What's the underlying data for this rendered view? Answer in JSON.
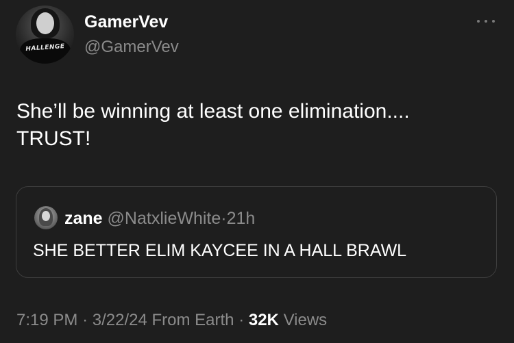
{
  "author": {
    "display_name": "GamerVev",
    "handle": "@GamerVev",
    "avatar_shirt_text": "HALLENGE"
  },
  "tweet": {
    "text_line1": "She’ll be winning at least one elimination....",
    "text_line2": "TRUST!"
  },
  "quoted_tweet": {
    "name": "zane",
    "handle": "@NatxlieWhite",
    "separator": "·",
    "time": "21h",
    "text": "SHE BETTER ELIM KAYCEE IN A HALL BRAWL"
  },
  "footer": {
    "time": "7:19 PM",
    "separator": "·",
    "date": "3/22/24",
    "location": "From Earth",
    "views_count": "32K",
    "views_label": "Views"
  },
  "icons": {
    "more": "more-horizontal-icon"
  },
  "colors": {
    "background": "#1e1e1e",
    "primary_text": "#ffffff",
    "secondary_text": "#8b8b8b",
    "border": "#3e3e3e"
  }
}
